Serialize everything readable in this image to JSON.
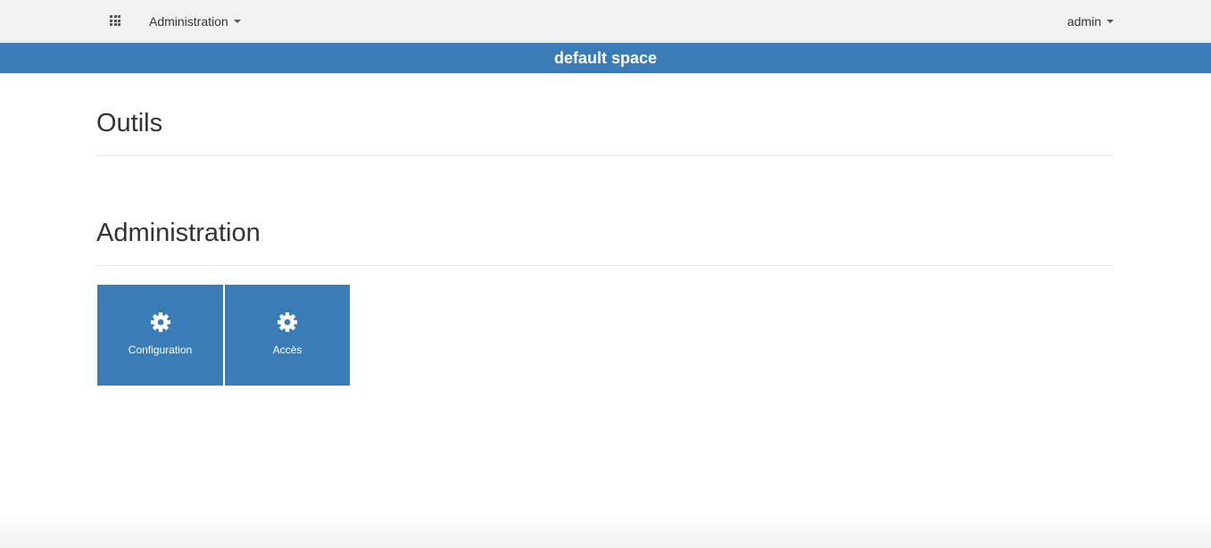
{
  "navbar": {
    "apps_icon": "grid-icon",
    "admin_menu_label": "Administration",
    "user_menu_label": "admin"
  },
  "space_bar": {
    "title": "default space"
  },
  "sections": [
    {
      "title": "Outils"
    },
    {
      "title": "Administration"
    }
  ],
  "tiles": [
    {
      "label": "Configuration",
      "icon": "gear-icon"
    },
    {
      "label": "Accès",
      "icon": "gear-icon"
    }
  ],
  "colors": {
    "navbar_bg": "#f2f2f2",
    "accent": "#3a7cb6",
    "text": "#333333"
  }
}
